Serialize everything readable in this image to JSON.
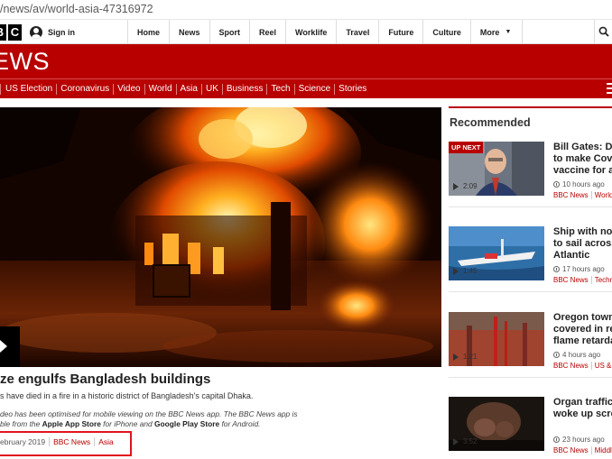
{
  "browser": {
    "url": "/news/av/world-asia-47316972"
  },
  "top_nav": {
    "logo_letters": [
      "B",
      "C"
    ],
    "sign_in": "Sign in",
    "links": [
      "Home",
      "News",
      "Sport",
      "Reel",
      "Worklife",
      "Travel",
      "Future",
      "Culture"
    ],
    "more": "More"
  },
  "brand": {
    "wordmark": "EWS"
  },
  "section_nav": [
    "US Election",
    "Coronavirus",
    "Video",
    "World",
    "Asia",
    "UK",
    "Business",
    "Tech",
    "Science",
    "Stories"
  ],
  "story": {
    "headline": "ze engulfs Bangladesh buildings",
    "summary": "s have died in a fire in a historic district of Bangladesh's capital Dhaka.",
    "note_1": "deo has been optimised for mobile viewing on the BBC News app. The BBC News app is",
    "note_2_pre": "ble from the ",
    "note_2_app_store": "Apple App Store",
    "note_2_mid": " for iPhone and ",
    "note_2_play_store": "Google Play Store",
    "note_2_post": " for Android.",
    "date": "ebruary 2019",
    "tags": [
      "BBC News",
      "Asia"
    ]
  },
  "recommended": {
    "title": "Recommended",
    "items": [
      {
        "badge": "UP NEXT",
        "duration": "2:09",
        "title": "Bill Gates: De\nto make Cov\nvaccine for a",
        "time": "10 hours ago",
        "tags": [
          "BBC News",
          "World"
        ]
      },
      {
        "badge": "",
        "duration": "1:45",
        "title": "Ship with no\nto sail across\nAtlantic",
        "time": "17 hours ago",
        "tags": [
          "BBC News",
          "Techn"
        ]
      },
      {
        "badge": "",
        "duration": "1:21",
        "title": "Oregon town\ncovered in re\nflame retarda",
        "time": "4 hours ago",
        "tags": [
          "BBC News",
          "US &"
        ]
      },
      {
        "badge": "",
        "duration": "3:52",
        "title": "Organ traffic\nwoke up scre",
        "time": "23 hours ago",
        "tags": [
          "BBC News",
          "Middl"
        ]
      }
    ]
  },
  "colors": {
    "brand_red": "#b80000",
    "highlight": "#e1141e"
  }
}
